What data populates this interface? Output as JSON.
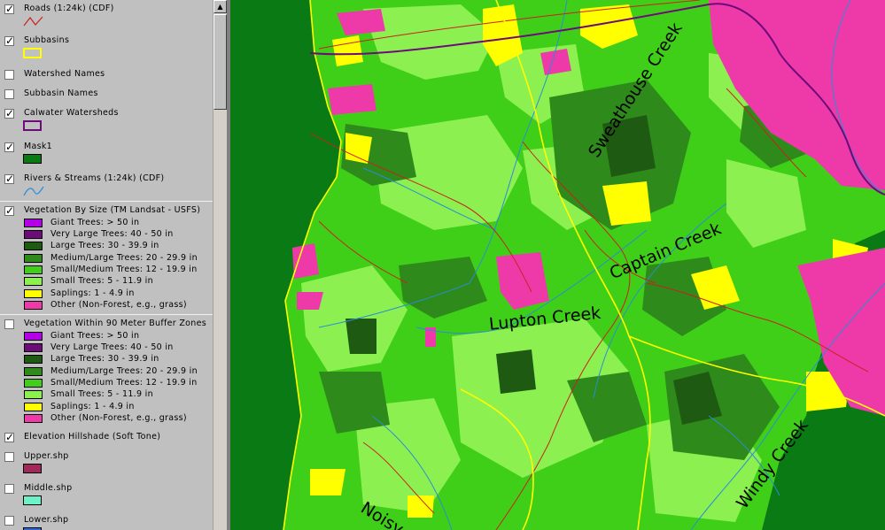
{
  "legend": {
    "layers": [
      {
        "name": "Roads (1:24k) (CDF)",
        "checked": true,
        "symbol": "road-line-symbol"
      },
      {
        "name": "Subbasins",
        "checked": true,
        "symbol": "yellow-outline-symbol"
      },
      {
        "name": "Watershed Names",
        "checked": false
      },
      {
        "name": "Subbasin Names",
        "checked": false
      },
      {
        "name": "Calwater Watersheds",
        "checked": true,
        "symbol": "purple-outline-symbol"
      },
      {
        "name": "Mask1",
        "checked": true,
        "symbol": "green-fill-symbol"
      },
      {
        "name": "Rivers & Streams (1:24k) (CDF)",
        "checked": true,
        "symbol": "stream-line-symbol"
      },
      {
        "name": "Vegetation By Size (TM Landsat - USFS)",
        "checked": true
      },
      {
        "name": "Vegetation Within 90 Meter Buffer Zones",
        "checked": false
      },
      {
        "name": "Elevation Hillshade (Soft Tone)",
        "checked": true
      },
      {
        "name": "Upper.shp",
        "checked": false,
        "symbol": "maroon-fill-symbol"
      },
      {
        "name": "Middle.shp",
        "checked": false,
        "symbol": "aqua-fill-symbol"
      },
      {
        "name": "Lower.shp",
        "checked": false,
        "symbol": "blue-fill-symbol"
      }
    ],
    "veg_classes": [
      {
        "label": "Giant Trees: > 50 in",
        "color": "#b400e6"
      },
      {
        "label": "Very Large Trees: 40 - 50 in",
        "color": "#6e0a7a"
      },
      {
        "label": "Large Trees: 30 - 39.9 in",
        "color": "#1f5a12"
      },
      {
        "label": "Medium/Large Trees: 20 - 29.9 in",
        "color": "#2e8a1a"
      },
      {
        "label": "Small/Medium Trees: 12 - 19.9 in",
        "color": "#3fcf18"
      },
      {
        "label": "Small Trees: 5 - 11.9 in",
        "color": "#8cf050"
      },
      {
        "label": "Saplings: 1 - 4.9 in",
        "color": "#ffff00"
      },
      {
        "label": "Other (Non-Forest, e.g., grass)",
        "color": "#ee3aa8"
      }
    ]
  },
  "map": {
    "creek_labels": [
      "Sweathouse Creek",
      "Captain Creek",
      "Lupton Creek",
      "Windy Creek",
      "Noisy C"
    ],
    "colors": {
      "mask": "#0a7a14",
      "small_medium": "#3fcf18",
      "small": "#8cf050",
      "medium_large": "#2e8a1a",
      "large": "#1f5a12",
      "saplings": "#ffff00",
      "other": "#ee3aa8",
      "roads": "#cc2020",
      "streams": "#2a8cd8",
      "watershed": "#6e0a7a"
    }
  }
}
